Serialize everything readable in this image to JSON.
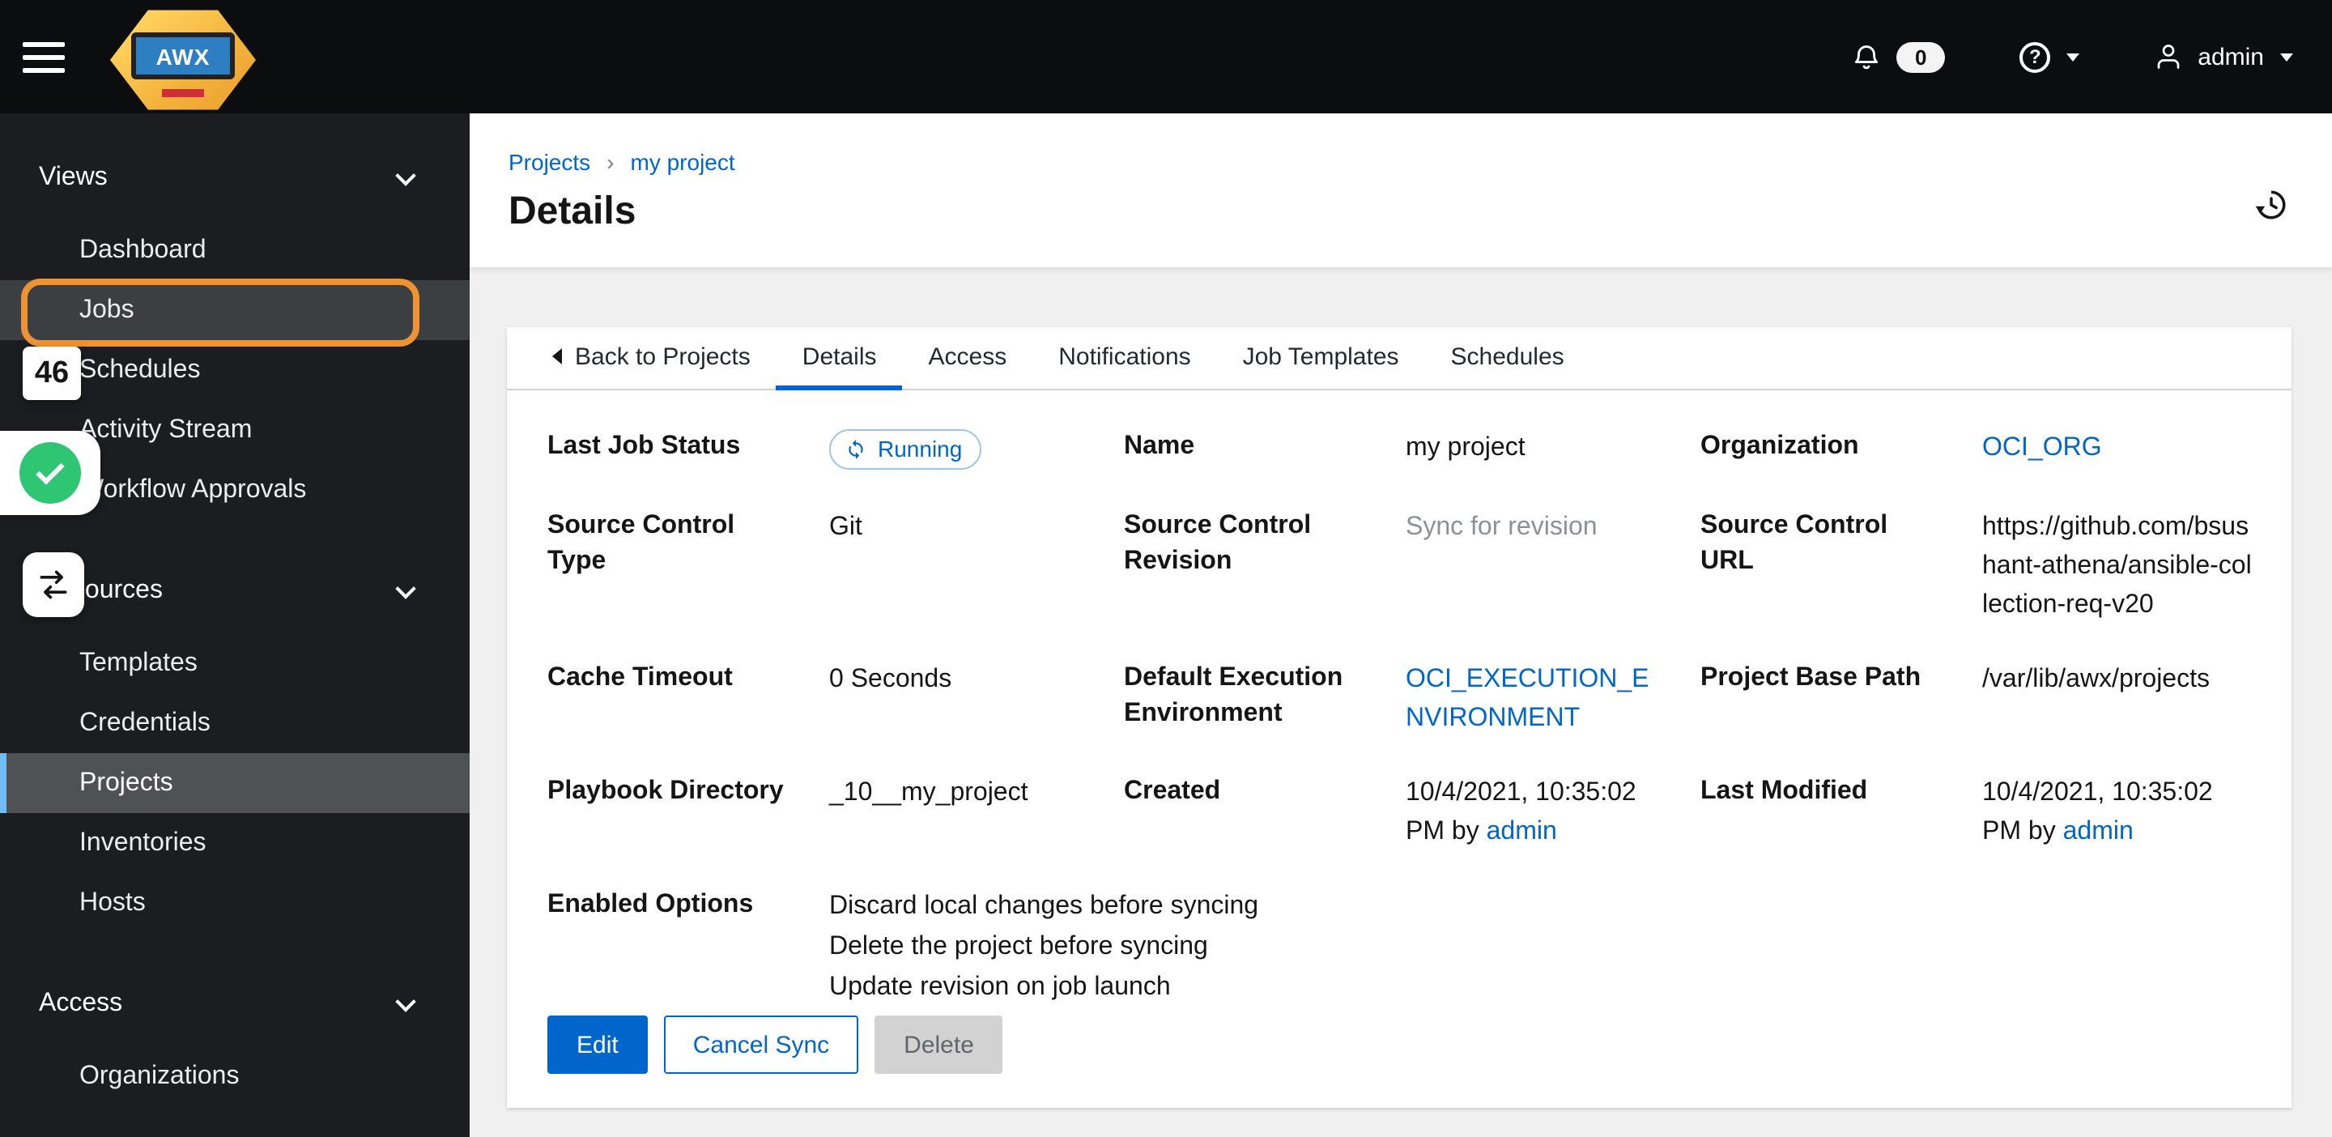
{
  "masthead": {
    "brand": "AWX",
    "notifications_count": "0",
    "help_glyph": "?",
    "username": "admin"
  },
  "sidebar": {
    "sections": [
      {
        "label": "Views",
        "items": [
          {
            "label": "Dashboard"
          },
          {
            "label": "Jobs"
          },
          {
            "label": "Schedules"
          },
          {
            "label": "Activity Stream"
          },
          {
            "label": "Workflow Approvals"
          }
        ]
      },
      {
        "label": "Resources",
        "items": [
          {
            "label": "Templates"
          },
          {
            "label": "Credentials"
          },
          {
            "label": "Projects"
          },
          {
            "label": "Inventories"
          },
          {
            "label": "Hosts"
          }
        ]
      },
      {
        "label": "Access",
        "items": [
          {
            "label": "Organizations"
          }
        ]
      }
    ],
    "active_item": "Projects",
    "highlighted_item": "Jobs"
  },
  "breadcrumb": {
    "root": "Projects",
    "separator": "›",
    "current": "my project"
  },
  "page_title": "Details",
  "tabs": {
    "back_label": "Back to Projects",
    "items": [
      "Details",
      "Access",
      "Notifications",
      "Job Templates",
      "Schedules"
    ],
    "active": "Details"
  },
  "details": {
    "last_job_status": {
      "label": "Last Job Status",
      "value": "Running"
    },
    "name": {
      "label": "Name",
      "value": "my project"
    },
    "organization": {
      "label": "Organization",
      "value": "OCI_ORG"
    },
    "source_control_type": {
      "label": "Source Control Type",
      "value": "Git"
    },
    "source_control_revision": {
      "label": "Source Control Revision",
      "value": "Sync for revision"
    },
    "source_control_url": {
      "label": "Source Control URL",
      "value": "https://github.com/bsushant-athena/ansible-collection-req-v20"
    },
    "cache_timeout": {
      "label": "Cache Timeout",
      "value": "0 Seconds"
    },
    "default_execution_environment": {
      "label": "Default Execution Environment",
      "value": "OCI_EXECUTION_ENVIRONMENT"
    },
    "project_base_path": {
      "label": "Project Base Path",
      "value": "/var/lib/awx/projects"
    },
    "playbook_directory": {
      "label": "Playbook Directory",
      "value": "_10__my_project"
    },
    "created": {
      "label": "Created",
      "value": "10/4/2021, 10:35:02 PM by",
      "link": "admin"
    },
    "last_modified": {
      "label": "Last Modified",
      "value": "10/4/2021, 10:35:02 PM by",
      "link": "admin"
    },
    "enabled_options": {
      "label": "Enabled Options",
      "values": [
        "Discard local changes before syncing",
        "Delete the project before syncing",
        "Update revision on job launch"
      ]
    }
  },
  "actions": {
    "edit": "Edit",
    "cancel_sync": "Cancel Sync",
    "delete": "Delete",
    "delete_disabled": true
  },
  "annotations": {
    "step_number": "46"
  },
  "colors": {
    "primary_blue": "#0066cc",
    "link_blue": "#0066cc",
    "masthead_bg": "#0c0d0f",
    "sidebar_bg": "#1b1d21",
    "selected_nav_bg": "#4f5255",
    "selected_nav_accent": "#73bcf7",
    "running_status": "#0066cc",
    "annotation_orange": "#ef9234",
    "annotation_green": "#2ec573",
    "disabled_gray": "#d2d2d2"
  }
}
